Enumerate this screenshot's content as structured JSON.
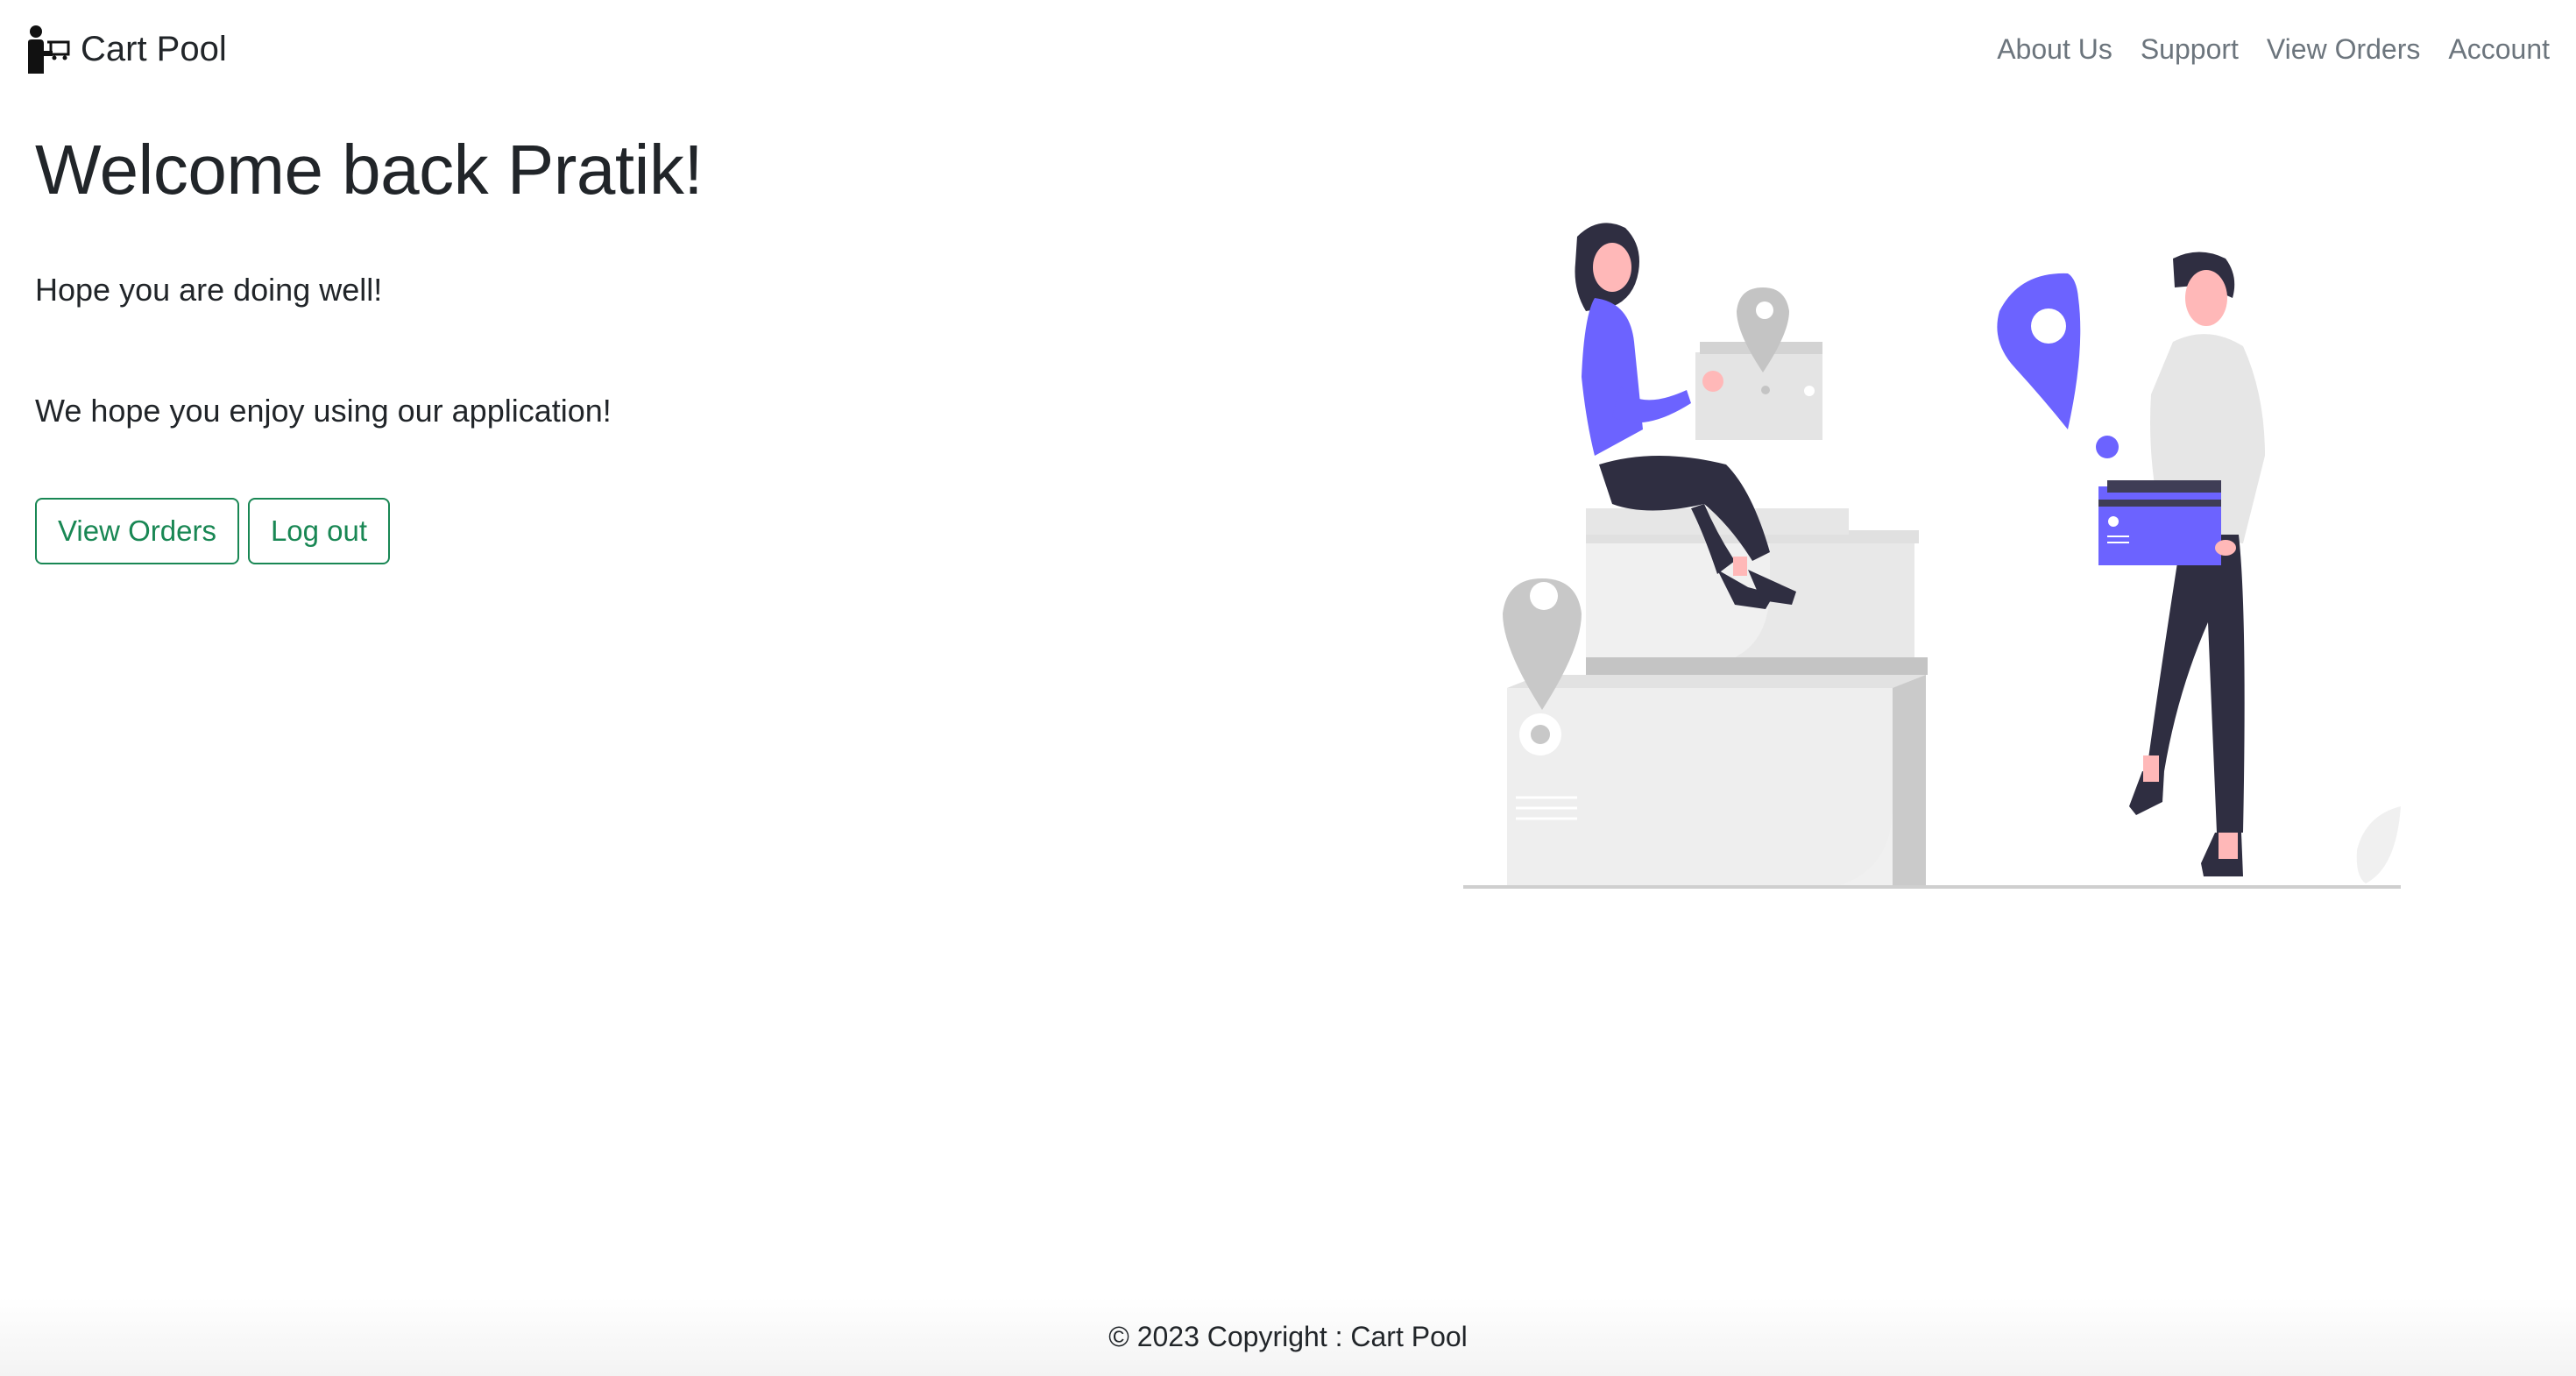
{
  "brand": {
    "name": "Cart Pool",
    "icon": "person-with-cart-icon"
  },
  "nav": {
    "items": [
      {
        "label": "About Us"
      },
      {
        "label": "Support"
      },
      {
        "label": "View Orders"
      },
      {
        "label": "Account"
      }
    ]
  },
  "main": {
    "heading": "Welcome back Pratik!",
    "line1": "Hope you are doing well!",
    "line2": "We hope you enjoy using our application!",
    "buttons": {
      "view_orders": "View Orders",
      "logout": "Log out"
    }
  },
  "footer": {
    "text": "© 2023 Copyright : Cart Pool"
  },
  "colors": {
    "accent": "#198754",
    "illustration_purple": "#6c63ff",
    "nav_text": "#6c757d"
  }
}
